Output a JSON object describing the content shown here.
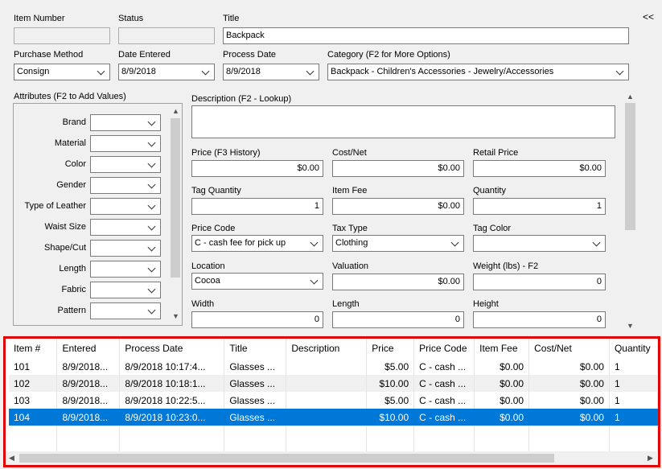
{
  "collapse_button": "<<",
  "header_fields": {
    "item_number": {
      "label": "Item Number",
      "value": ""
    },
    "status": {
      "label": "Status",
      "value": ""
    },
    "title": {
      "label": "Title",
      "value": "Backpack"
    },
    "purchase_method": {
      "label": "Purchase Method",
      "value": "Consign"
    },
    "date_entered": {
      "label": "Date Entered",
      "value": "8/9/2018"
    },
    "process_date": {
      "label": "Process Date",
      "value": "8/9/2018"
    },
    "category": {
      "label": "Category (F2 for More Options)",
      "value": "Backpack - Children's Accessories - Jewelry/Accessories"
    }
  },
  "attributes": {
    "label": "Attributes (F2 to Add Values)",
    "items": [
      {
        "name": "Brand",
        "value": ""
      },
      {
        "name": "Material",
        "value": ""
      },
      {
        "name": "Color",
        "value": ""
      },
      {
        "name": "Gender",
        "value": ""
      },
      {
        "name": "Type of Leather",
        "value": ""
      },
      {
        "name": "Waist Size",
        "value": ""
      },
      {
        "name": "Shape/Cut",
        "value": ""
      },
      {
        "name": "Length",
        "value": ""
      },
      {
        "name": "Fabric",
        "value": ""
      },
      {
        "name": "Pattern",
        "value": ""
      }
    ]
  },
  "details": {
    "description": {
      "label": "Description (F2 - Lookup)",
      "value": ""
    },
    "price": {
      "label": "Price (F3 History)",
      "value": "$0.00"
    },
    "cost_net": {
      "label": "Cost/Net",
      "value": "$0.00"
    },
    "retail_price": {
      "label": "Retail Price",
      "value": "$0.00"
    },
    "tag_quantity": {
      "label": "Tag Quantity",
      "value": "1"
    },
    "item_fee": {
      "label": "Item Fee",
      "value": "$0.00"
    },
    "quantity": {
      "label": "Quantity",
      "value": "1"
    },
    "price_code": {
      "label": "Price Code",
      "value": "C - cash fee for pick up"
    },
    "tax_type": {
      "label": "Tax Type",
      "value": "Clothing"
    },
    "tag_color": {
      "label": "Tag Color",
      "value": ""
    },
    "location": {
      "label": "Location",
      "value": "Cocoa"
    },
    "valuation": {
      "label": "Valuation",
      "value": "$0.00"
    },
    "weight": {
      "label": "Weight (lbs) - F2",
      "value": "0"
    },
    "width": {
      "label": "Width",
      "value": "0"
    },
    "length": {
      "label": "Length",
      "value": "0"
    },
    "height": {
      "label": "Height",
      "value": "0"
    }
  },
  "grid": {
    "columns": [
      "Item #",
      "Entered",
      "Process Date",
      "Title",
      "Description",
      "Price",
      "Price Code",
      "Item Fee",
      "Cost/Net",
      "Quantity"
    ],
    "rows": [
      {
        "item": "101",
        "entered": "8/9/2018...",
        "process": "8/9/2018 10:17:4...",
        "title": "Glasses ...",
        "description": "",
        "price": "$5.00",
        "price_code": "C - cash ...",
        "item_fee": "$0.00",
        "cost_net": "$0.00",
        "quantity": "1"
      },
      {
        "item": "102",
        "entered": "8/9/2018...",
        "process": "8/9/2018 10:18:1...",
        "title": "Glasses ...",
        "description": "",
        "price": "$10.00",
        "price_code": "C - cash ...",
        "item_fee": "$0.00",
        "cost_net": "$0.00",
        "quantity": "1"
      },
      {
        "item": "103",
        "entered": "8/9/2018...",
        "process": "8/9/2018 10:22:5...",
        "title": "Glasses ...",
        "description": "",
        "price": "$5.00",
        "price_code": "C - cash ...",
        "item_fee": "$0.00",
        "cost_net": "$0.00",
        "quantity": "1"
      },
      {
        "item": "104",
        "entered": "8/9/2018...",
        "process": "8/9/2018 10:23:0...",
        "title": "Glasses ...",
        "description": "",
        "price": "$10.00",
        "price_code": "C - cash ...",
        "item_fee": "$0.00",
        "cost_net": "$0.00",
        "quantity": "1"
      }
    ],
    "selected_row": 3
  },
  "colors": {
    "selection": "#0078d7",
    "highlight_border": "#e00000"
  }
}
